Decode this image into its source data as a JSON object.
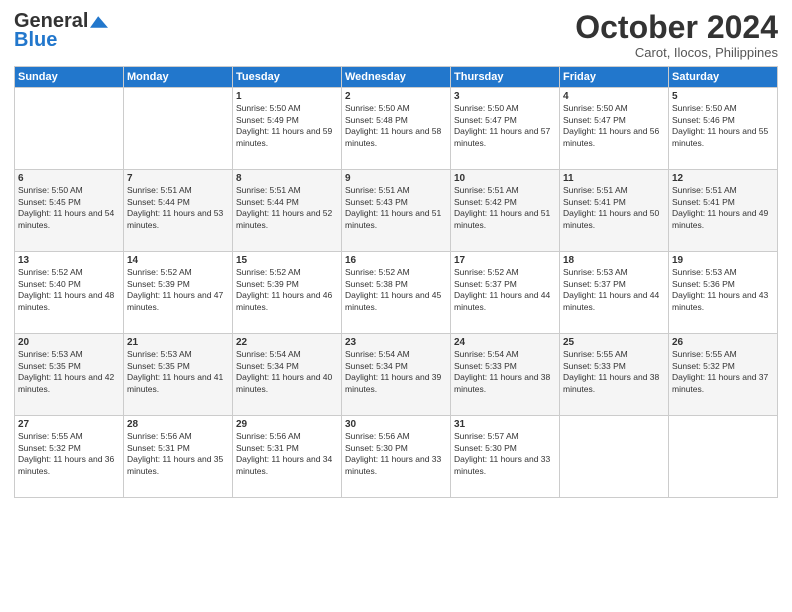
{
  "header": {
    "logo_line1": "General",
    "logo_line2": "Blue",
    "month": "October 2024",
    "location": "Carot, Ilocos, Philippines"
  },
  "days_of_week": [
    "Sunday",
    "Monday",
    "Tuesday",
    "Wednesday",
    "Thursday",
    "Friday",
    "Saturday"
  ],
  "weeks": [
    [
      {
        "day": "",
        "content": ""
      },
      {
        "day": "",
        "content": ""
      },
      {
        "day": "1",
        "content": "Sunrise: 5:50 AM\nSunset: 5:49 PM\nDaylight: 11 hours and 59 minutes."
      },
      {
        "day": "2",
        "content": "Sunrise: 5:50 AM\nSunset: 5:48 PM\nDaylight: 11 hours and 58 minutes."
      },
      {
        "day": "3",
        "content": "Sunrise: 5:50 AM\nSunset: 5:47 PM\nDaylight: 11 hours and 57 minutes."
      },
      {
        "day": "4",
        "content": "Sunrise: 5:50 AM\nSunset: 5:47 PM\nDaylight: 11 hours and 56 minutes."
      },
      {
        "day": "5",
        "content": "Sunrise: 5:50 AM\nSunset: 5:46 PM\nDaylight: 11 hours and 55 minutes."
      }
    ],
    [
      {
        "day": "6",
        "content": "Sunrise: 5:50 AM\nSunset: 5:45 PM\nDaylight: 11 hours and 54 minutes."
      },
      {
        "day": "7",
        "content": "Sunrise: 5:51 AM\nSunset: 5:44 PM\nDaylight: 11 hours and 53 minutes."
      },
      {
        "day": "8",
        "content": "Sunrise: 5:51 AM\nSunset: 5:44 PM\nDaylight: 11 hours and 52 minutes."
      },
      {
        "day": "9",
        "content": "Sunrise: 5:51 AM\nSunset: 5:43 PM\nDaylight: 11 hours and 51 minutes."
      },
      {
        "day": "10",
        "content": "Sunrise: 5:51 AM\nSunset: 5:42 PM\nDaylight: 11 hours and 51 minutes."
      },
      {
        "day": "11",
        "content": "Sunrise: 5:51 AM\nSunset: 5:41 PM\nDaylight: 11 hours and 50 minutes."
      },
      {
        "day": "12",
        "content": "Sunrise: 5:51 AM\nSunset: 5:41 PM\nDaylight: 11 hours and 49 minutes."
      }
    ],
    [
      {
        "day": "13",
        "content": "Sunrise: 5:52 AM\nSunset: 5:40 PM\nDaylight: 11 hours and 48 minutes."
      },
      {
        "day": "14",
        "content": "Sunrise: 5:52 AM\nSunset: 5:39 PM\nDaylight: 11 hours and 47 minutes."
      },
      {
        "day": "15",
        "content": "Sunrise: 5:52 AM\nSunset: 5:39 PM\nDaylight: 11 hours and 46 minutes."
      },
      {
        "day": "16",
        "content": "Sunrise: 5:52 AM\nSunset: 5:38 PM\nDaylight: 11 hours and 45 minutes."
      },
      {
        "day": "17",
        "content": "Sunrise: 5:52 AM\nSunset: 5:37 PM\nDaylight: 11 hours and 44 minutes."
      },
      {
        "day": "18",
        "content": "Sunrise: 5:53 AM\nSunset: 5:37 PM\nDaylight: 11 hours and 44 minutes."
      },
      {
        "day": "19",
        "content": "Sunrise: 5:53 AM\nSunset: 5:36 PM\nDaylight: 11 hours and 43 minutes."
      }
    ],
    [
      {
        "day": "20",
        "content": "Sunrise: 5:53 AM\nSunset: 5:35 PM\nDaylight: 11 hours and 42 minutes."
      },
      {
        "day": "21",
        "content": "Sunrise: 5:53 AM\nSunset: 5:35 PM\nDaylight: 11 hours and 41 minutes."
      },
      {
        "day": "22",
        "content": "Sunrise: 5:54 AM\nSunset: 5:34 PM\nDaylight: 11 hours and 40 minutes."
      },
      {
        "day": "23",
        "content": "Sunrise: 5:54 AM\nSunset: 5:34 PM\nDaylight: 11 hours and 39 minutes."
      },
      {
        "day": "24",
        "content": "Sunrise: 5:54 AM\nSunset: 5:33 PM\nDaylight: 11 hours and 38 minutes."
      },
      {
        "day": "25",
        "content": "Sunrise: 5:55 AM\nSunset: 5:33 PM\nDaylight: 11 hours and 38 minutes."
      },
      {
        "day": "26",
        "content": "Sunrise: 5:55 AM\nSunset: 5:32 PM\nDaylight: 11 hours and 37 minutes."
      }
    ],
    [
      {
        "day": "27",
        "content": "Sunrise: 5:55 AM\nSunset: 5:32 PM\nDaylight: 11 hours and 36 minutes."
      },
      {
        "day": "28",
        "content": "Sunrise: 5:56 AM\nSunset: 5:31 PM\nDaylight: 11 hours and 35 minutes."
      },
      {
        "day": "29",
        "content": "Sunrise: 5:56 AM\nSunset: 5:31 PM\nDaylight: 11 hours and 34 minutes."
      },
      {
        "day": "30",
        "content": "Sunrise: 5:56 AM\nSunset: 5:30 PM\nDaylight: 11 hours and 33 minutes."
      },
      {
        "day": "31",
        "content": "Sunrise: 5:57 AM\nSunset: 5:30 PM\nDaylight: 11 hours and 33 minutes."
      },
      {
        "day": "",
        "content": ""
      },
      {
        "day": "",
        "content": ""
      }
    ]
  ]
}
